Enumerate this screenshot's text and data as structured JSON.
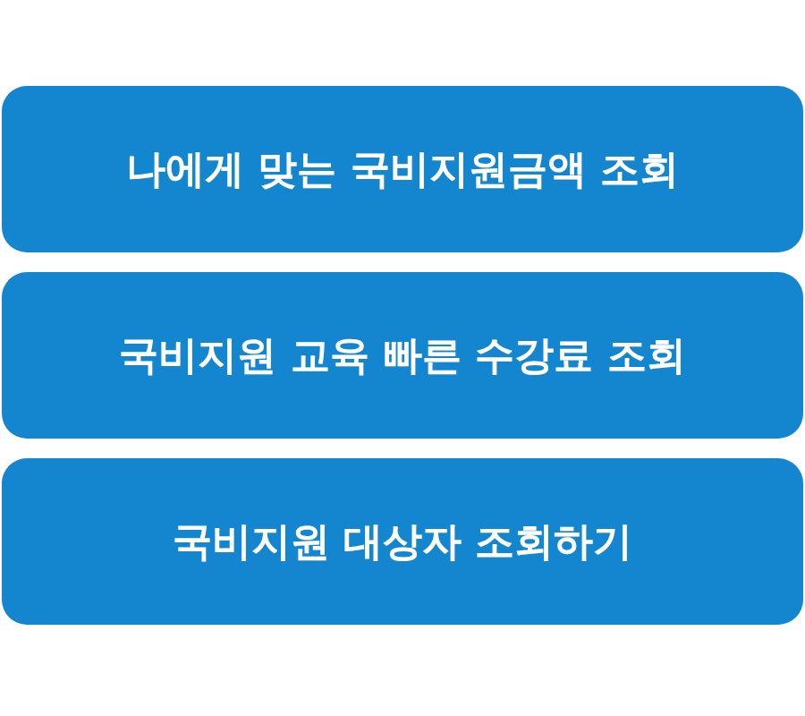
{
  "buttons": [
    "나에게 맞는 국비지원금액 조회",
    "국비지원 교육 빠른 수강료 조회",
    "국비지원 대상자 조회하기"
  ]
}
